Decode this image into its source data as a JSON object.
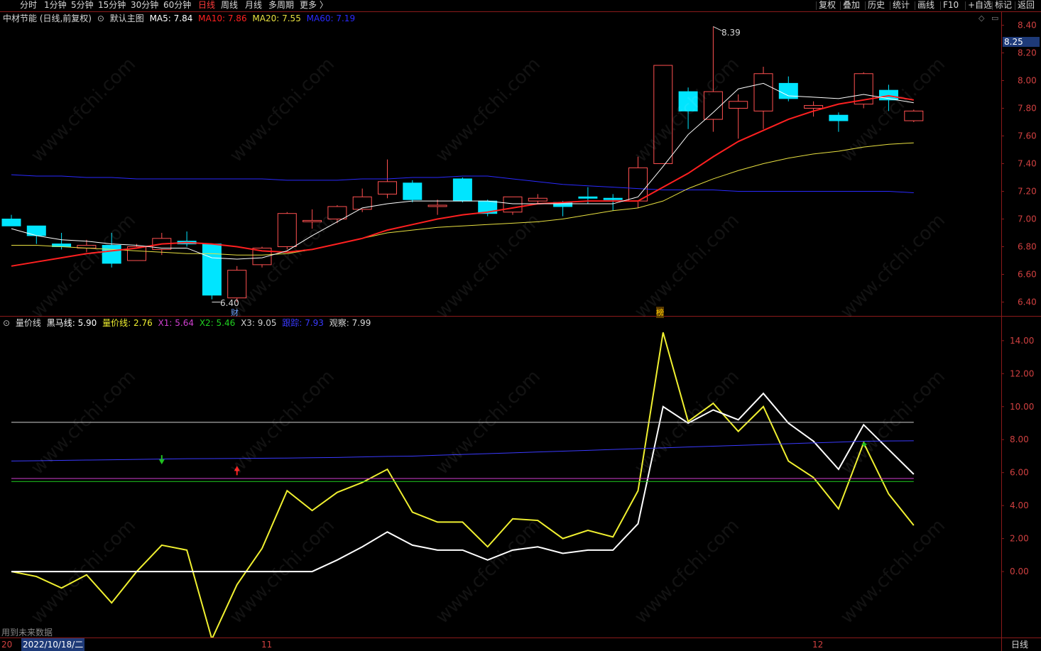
{
  "toolbar": {
    "periods": [
      {
        "label": "分时",
        "active": false
      },
      {
        "label": "1分钟",
        "active": false
      },
      {
        "label": "5分钟",
        "active": false
      },
      {
        "label": "15分钟",
        "active": false
      },
      {
        "label": "30分钟",
        "active": false
      },
      {
        "label": "60分钟",
        "active": false
      },
      {
        "label": "日线",
        "active": true
      },
      {
        "label": "周线",
        "active": false
      },
      {
        "label": "月线",
        "active": false
      },
      {
        "label": "多周期",
        "active": false
      },
      {
        "label": "更多 〉",
        "active": false
      }
    ],
    "right_buttons": [
      "复权",
      "叠加",
      "历史",
      "统计",
      "画线",
      "F10",
      "+自选",
      "标记",
      "返回"
    ]
  },
  "main_legend": {
    "stock": "中材节能 (日线,前复权)",
    "template": "默认主图",
    "ma5": "MA5: 7.84",
    "ma10": "MA10: 7.86",
    "ma20": "MA20: 7.55",
    "ma60": "MA60: 7.19",
    "colors": {
      "ma5": "#ffffff",
      "ma10": "#ff2020",
      "ma20": "#e8e040",
      "ma60": "#2a2aff"
    }
  },
  "sub_legend": {
    "name": "量价线",
    "heima": "黑马线: 5.90",
    "ljx": "量价线: 2.76",
    "x1": "X1: 5.64",
    "x2": "X2: 5.46",
    "x3": "X3: 9.05",
    "gz": "跟踪: 7.93",
    "gc": "观察: 7.99"
  },
  "price_axis": [
    "8.40",
    "8.20",
    "8.00",
    "7.80",
    "7.60",
    "7.40",
    "7.20",
    "7.00",
    "6.80",
    "6.60",
    "6.40"
  ],
  "current_price": "8.25",
  "sub_axis": [
    "14.00",
    "12.00",
    "10.00",
    "8.00",
    "6.00",
    "4.00",
    "2.00",
    "0.00"
  ],
  "annotations": {
    "high": "8.39",
    "low": "6.40",
    "cai": "财",
    "bang": "榜"
  },
  "bottom": {
    "date": "2022/10/18/二",
    "left": "20",
    "nov": "11",
    "dec": "12",
    "status": "用到未来数据",
    "period_btn": "日线"
  },
  "watermark": "www.cfchi.com",
  "chart_data": [
    {
      "type": "candlestick",
      "title": "中材节能 (日线,前复权)",
      "ylim": [
        6.3,
        8.5
      ],
      "candles": [
        {
          "o": 7.0,
          "h": 7.03,
          "l": 6.98,
          "c": 6.95
        },
        {
          "o": 6.95,
          "h": 6.95,
          "l": 6.82,
          "c": 6.88
        },
        {
          "o": 6.82,
          "h": 6.9,
          "l": 6.78,
          "c": 6.8
        },
        {
          "o": 6.79,
          "h": 6.85,
          "l": 6.76,
          "c": 6.81
        },
        {
          "o": 6.81,
          "h": 6.9,
          "l": 6.65,
          "c": 6.68
        },
        {
          "o": 6.7,
          "h": 6.82,
          "l": 6.7,
          "c": 6.8
        },
        {
          "o": 6.78,
          "h": 6.9,
          "l": 6.74,
          "c": 6.86
        },
        {
          "o": 6.84,
          "h": 6.91,
          "l": 6.8,
          "c": 6.82
        },
        {
          "o": 6.82,
          "h": 6.82,
          "l": 6.42,
          "c": 6.45
        },
        {
          "o": 6.43,
          "h": 6.66,
          "l": 6.4,
          "c": 6.63
        },
        {
          "o": 6.67,
          "h": 6.8,
          "l": 6.65,
          "c": 6.79
        },
        {
          "o": 6.8,
          "h": 7.05,
          "l": 6.78,
          "c": 7.04
        },
        {
          "o": 6.98,
          "h": 7.07,
          "l": 6.93,
          "c": 6.99
        },
        {
          "o": 7.0,
          "h": 7.1,
          "l": 6.97,
          "c": 7.09
        },
        {
          "o": 7.07,
          "h": 7.22,
          "l": 7.05,
          "c": 7.16
        },
        {
          "o": 7.18,
          "h": 7.43,
          "l": 7.15,
          "c": 7.27
        },
        {
          "o": 7.26,
          "h": 7.28,
          "l": 7.12,
          "c": 7.14
        },
        {
          "o": 7.09,
          "h": 7.14,
          "l": 7.03,
          "c": 7.1
        },
        {
          "o": 7.29,
          "h": 7.3,
          "l": 7.12,
          "c": 7.13
        },
        {
          "o": 7.13,
          "h": 7.14,
          "l": 7.02,
          "c": 7.04
        },
        {
          "o": 7.05,
          "h": 7.15,
          "l": 7.03,
          "c": 7.16
        },
        {
          "o": 7.13,
          "h": 7.18,
          "l": 7.11,
          "c": 7.15
        },
        {
          "o": 7.12,
          "h": 7.13,
          "l": 7.02,
          "c": 7.09
        },
        {
          "o": 7.16,
          "h": 7.23,
          "l": 7.11,
          "c": 7.15
        },
        {
          "o": 7.15,
          "h": 7.18,
          "l": 7.06,
          "c": 7.14
        },
        {
          "o": 7.13,
          "h": 7.45,
          "l": 7.08,
          "c": 7.37
        },
        {
          "o": 7.4,
          "h": 8.11,
          "l": 7.4,
          "c": 8.11
        },
        {
          "o": 7.92,
          "h": 7.95,
          "l": 7.65,
          "c": 7.78
        },
        {
          "o": 7.72,
          "h": 8.39,
          "l": 7.63,
          "c": 7.92
        },
        {
          "o": 7.8,
          "h": 7.9,
          "l": 7.58,
          "c": 7.85
        },
        {
          "o": 7.78,
          "h": 8.1,
          "l": 7.65,
          "c": 8.05
        },
        {
          "o": 7.98,
          "h": 8.03,
          "l": 7.85,
          "c": 7.87
        },
        {
          "o": 7.8,
          "h": 7.85,
          "l": 7.74,
          "c": 7.82
        },
        {
          "o": 7.75,
          "h": 7.77,
          "l": 7.63,
          "c": 7.71
        },
        {
          "o": 7.83,
          "h": 8.06,
          "l": 7.8,
          "c": 8.05
        },
        {
          "o": 7.93,
          "h": 7.97,
          "l": 7.78,
          "c": 7.86
        },
        {
          "o": 7.71,
          "h": 7.79,
          "l": 7.7,
          "c": 7.78
        }
      ],
      "ma5": [
        6.93,
        6.88,
        6.85,
        6.84,
        6.82,
        6.81,
        6.79,
        6.79,
        6.72,
        6.71,
        6.72,
        6.77,
        6.88,
        6.98,
        7.08,
        7.11,
        7.13,
        7.13,
        7.13,
        7.13,
        7.11,
        7.11,
        7.11,
        7.11,
        7.11,
        7.16,
        7.38,
        7.61,
        7.77,
        7.94,
        7.98,
        7.89,
        7.88,
        7.87,
        7.9,
        7.87,
        7.84
      ],
      "ma10": [
        6.66,
        6.69,
        6.72,
        6.75,
        6.77,
        6.79,
        6.82,
        6.83,
        6.82,
        6.8,
        6.77,
        6.76,
        6.78,
        6.82,
        6.86,
        6.92,
        6.96,
        7.0,
        7.03,
        7.05,
        7.08,
        7.11,
        7.12,
        7.13,
        7.13,
        7.13,
        7.23,
        7.33,
        7.45,
        7.56,
        7.64,
        7.72,
        7.78,
        7.83,
        7.86,
        7.89,
        7.86
      ],
      "ma20": [
        6.81,
        6.81,
        6.8,
        6.79,
        6.78,
        6.77,
        6.76,
        6.75,
        6.75,
        6.74,
        6.74,
        6.75,
        6.78,
        6.82,
        6.86,
        6.9,
        6.92,
        6.94,
        6.95,
        6.96,
        6.97,
        6.98,
        7.0,
        7.03,
        7.06,
        7.08,
        7.13,
        7.22,
        7.29,
        7.35,
        7.4,
        7.44,
        7.47,
        7.49,
        7.52,
        7.54,
        7.55
      ],
      "ma60": [
        7.32,
        7.31,
        7.31,
        7.3,
        7.3,
        7.29,
        7.29,
        7.29,
        7.29,
        7.29,
        7.29,
        7.28,
        7.28,
        7.28,
        7.29,
        7.29,
        7.3,
        7.3,
        7.31,
        7.31,
        7.29,
        7.27,
        7.25,
        7.24,
        7.23,
        7.22,
        7.21,
        7.21,
        7.21,
        7.2,
        7.2,
        7.2,
        7.2,
        7.2,
        7.2,
        7.2,
        7.19
      ]
    },
    {
      "type": "line",
      "title": "量价线",
      "ylim": [
        -4.0,
        15.5
      ],
      "series": [
        {
          "name": "量价线",
          "color": "#f0f030",
          "values": [
            0.0,
            -0.3,
            -1.0,
            -0.2,
            -1.9,
            0.0,
            1.6,
            1.3,
            -4.1,
            -0.8,
            1.4,
            4.9,
            3.7,
            4.8,
            5.4,
            6.2,
            3.6,
            3.0,
            3.0,
            1.5,
            3.2,
            3.1,
            2.0,
            2.5,
            2.1,
            4.9,
            14.5,
            9.1,
            10.2,
            8.5,
            10.0,
            6.7,
            5.7,
            3.8,
            7.8,
            4.7,
            2.8
          ]
        },
        {
          "name": "黑马线",
          "color": "#ffffff",
          "values": [
            0.0,
            0.0,
            0.0,
            0.0,
            0.0,
            0.0,
            0.0,
            0.0,
            0.0,
            0.0,
            0.0,
            0.0,
            0.0,
            0.7,
            1.5,
            2.4,
            1.6,
            1.3,
            1.3,
            0.7,
            1.3,
            1.5,
            1.1,
            1.3,
            1.3,
            2.9,
            10.0,
            9.0,
            9.8,
            9.2,
            10.8,
            9.0,
            7.9,
            6.2,
            8.9,
            7.4,
            5.9
          ]
        },
        {
          "name": "跟踪",
          "color": "#3a3aff",
          "values": [
            6.7,
            6.72,
            6.74,
            6.76,
            6.78,
            6.8,
            6.82,
            6.84,
            6.85,
            6.86,
            6.87,
            6.88,
            6.9,
            6.92,
            6.95,
            6.98,
            7.0,
            7.05,
            7.1,
            7.15,
            7.2,
            7.25,
            7.3,
            7.35,
            7.4,
            7.45,
            7.5,
            7.55,
            7.6,
            7.65,
            7.7,
            7.75,
            7.8,
            7.85,
            7.9,
            7.92,
            7.93
          ]
        },
        {
          "name": "X1",
          "color": "#d040d0",
          "values": [
            5.64
          ]
        },
        {
          "name": "X2",
          "color": "#20d020",
          "values": [
            5.46
          ]
        },
        {
          "name": "X3",
          "color": "#d0d0d0",
          "values": [
            9.05
          ]
        }
      ],
      "markers": [
        {
          "index": 6,
          "type": "down-arrow",
          "color": "#20c020",
          "value": 6.8
        },
        {
          "index": 9,
          "type": "up-arrow",
          "color": "#ff2020",
          "value": 6.1
        },
        {
          "index": 34,
          "type": "star",
          "color": "#20c020",
          "value": 7.7
        }
      ]
    }
  ]
}
